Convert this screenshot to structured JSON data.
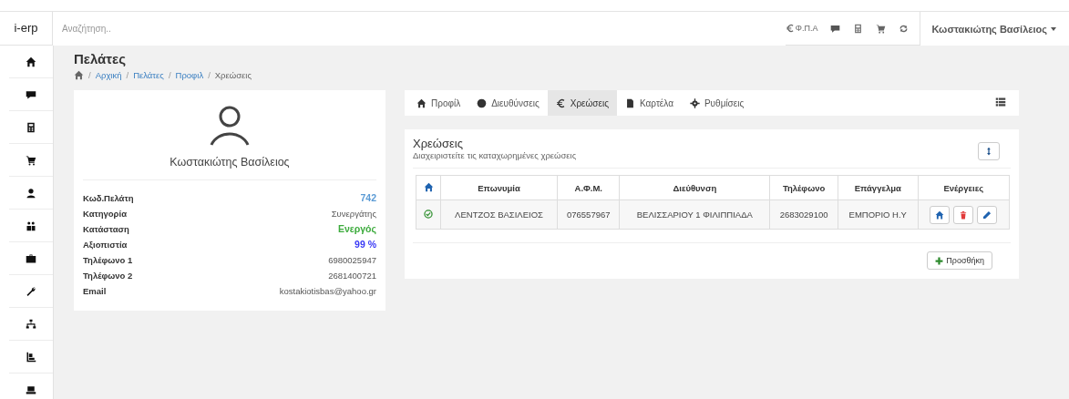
{
  "header": {
    "brand": "i-erp",
    "search": {
      "placeholder": "Αναζήτηση.."
    },
    "vat": "Φ.Π.Α",
    "user": "Κωστακιώτης Βασίλειος"
  },
  "page": {
    "title": "Πελάτες",
    "separator": "/",
    "breadcrumb": [
      {
        "label": "Αρχική",
        "link": true
      },
      {
        "label": "Πελάτες",
        "link": true
      },
      {
        "label": "Προφιλ",
        "link": true
      },
      {
        "label": "Χρεώσεις",
        "link": false
      }
    ]
  },
  "profile": {
    "name": "Κωστακιώτης Βασίλειος",
    "rows": [
      {
        "label": "Κωδ.Πελάτη",
        "value": "742",
        "color": "#5b9bd5"
      },
      {
        "label": "Κατηγορία",
        "value": "Συνεργάτης"
      },
      {
        "label": "Κατάσταση",
        "value": "Ενεργός",
        "color": "#3cab3c"
      },
      {
        "label": "Αξιοπιστία",
        "value": "99 %",
        "color": "#3b3bf5"
      },
      {
        "label": "Τηλέφωνο 1",
        "value": "6980025947"
      },
      {
        "label": "Τηλέφωνο 2",
        "value": "2681400721"
      },
      {
        "label": "Email",
        "value": "kostakiotisbas@yahoo.gr"
      }
    ]
  },
  "tabs": [
    {
      "label": "Προφίλ",
      "selected": false
    },
    {
      "label": "Διευθύνσεις",
      "selected": false
    },
    {
      "label": "Χρεώσεις",
      "selected": true
    },
    {
      "label": "Καρτέλα",
      "selected": false
    },
    {
      "label": "Ρυθμίσεις",
      "selected": false
    }
  ],
  "panel": {
    "title": "Χρεώσεις",
    "subtitle": "Διαχειριστείτε τις καταχωρημένες χρεώσεις",
    "add_button": "Προσθήκη",
    "table": {
      "columns": [
        "Επωνυμία",
        "Α.Φ.Μ.",
        "Διεύθυνση",
        "Τηλέφωνο",
        "Επάγγελμα",
        "Ενέργειες"
      ],
      "rows": [
        {
          "active": true,
          "cells": [
            "ΛΕΝΤΖΟΣ ΒΑΣΙΛΕΙΟΣ",
            "076557967",
            "ΒΕΛΙΣΣΑΡΙΟΥ 1 ΦΙΛΙΠΠΙΑΔΑ",
            "2683029100",
            "ΕΜΠΟΡΙΟ Η.Υ"
          ]
        }
      ]
    }
  }
}
